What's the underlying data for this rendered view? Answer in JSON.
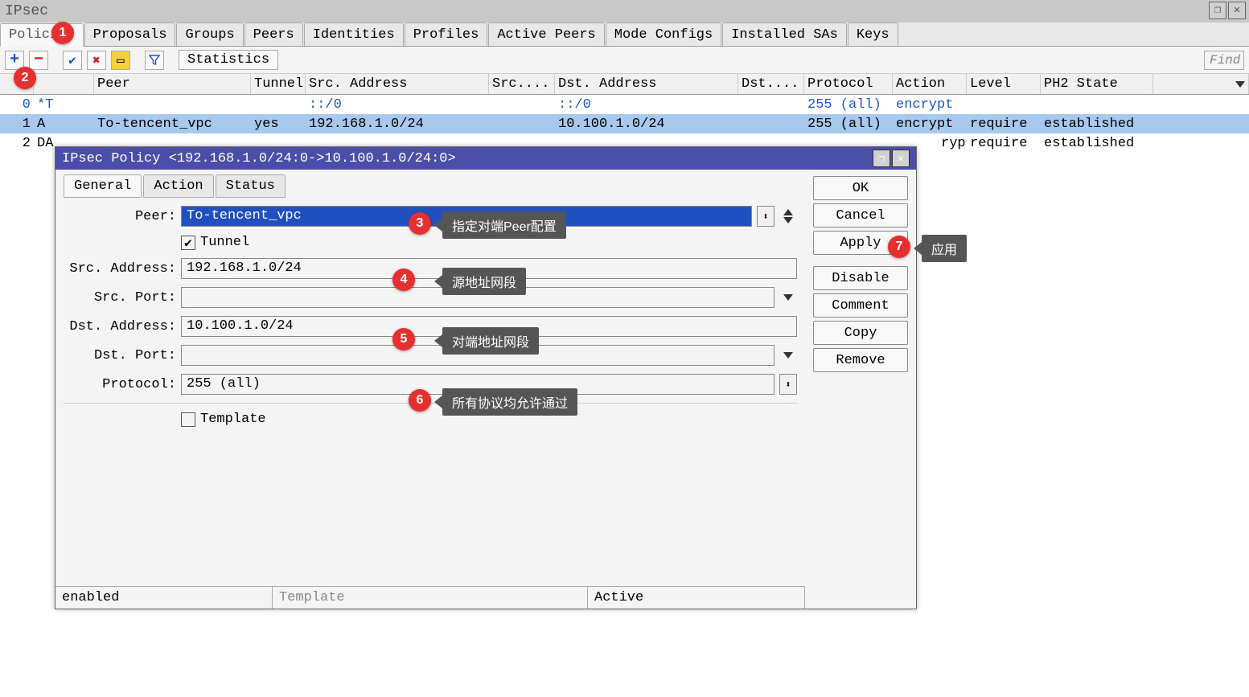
{
  "window": {
    "title": "IPsec"
  },
  "tabs": [
    "Policies",
    "Proposals",
    "Groups",
    "Peers",
    "Identities",
    "Profiles",
    "Active Peers",
    "Mode Configs",
    "Installed SAs",
    "Keys"
  ],
  "toolbar": {
    "statistics": "Statistics",
    "find": "Find"
  },
  "grid": {
    "headers": {
      "num": "#",
      "peer": "Peer",
      "tunnel": "Tunnel",
      "src": "Src. Address",
      "srcport": "Src....",
      "dst": "Dst. Address",
      "dstport": "Dst....",
      "proto": "Protocol",
      "action": "Action",
      "level": "Level",
      "ph2": "PH2 State"
    },
    "rows": [
      {
        "num": "0",
        "flag": "*T",
        "peer": "",
        "tunnel": "",
        "src": "::/0",
        "srcport": "",
        "dst": "::/0",
        "dstport": "",
        "proto": "255 (all)",
        "action": "encrypt",
        "level": "",
        "ph2": ""
      },
      {
        "num": "1",
        "flag": "A",
        "peer": "To-tencent_vpc",
        "tunnel": "yes",
        "src": "192.168.1.0/24",
        "srcport": "",
        "dst": "10.100.1.0/24",
        "dstport": "",
        "proto": "255 (all)",
        "action": "encrypt",
        "level": "require",
        "ph2": "established"
      },
      {
        "num": "2",
        "flag": "DA",
        "peer": "",
        "tunnel": "",
        "src": "",
        "srcport": "",
        "dst": "",
        "dstport": "",
        "proto": "",
        "action": "rypt",
        "level": "require",
        "ph2": "established"
      }
    ]
  },
  "dialog": {
    "title": "IPsec Policy <192.168.1.0/24:0->10.100.1.0/24:0>",
    "tabs": [
      "General",
      "Action",
      "Status"
    ],
    "labels": {
      "peer": "Peer:",
      "tunnel": "Tunnel",
      "src": "Src. Address:",
      "srcport": "Src. Port:",
      "dst": "Dst. Address:",
      "dstport": "Dst. Port:",
      "proto": "Protocol:",
      "template": "Template"
    },
    "values": {
      "peer": "To-tencent_vpc",
      "src": "192.168.1.0/24",
      "srcport": "",
      "dst": "10.100.1.0/24",
      "dstport": "",
      "proto": "255 (all)"
    },
    "buttons": {
      "ok": "OK",
      "cancel": "Cancel",
      "apply": "Apply",
      "disable": "Disable",
      "comment": "Comment",
      "copy": "Copy",
      "remove": "Remove"
    },
    "status": {
      "enabled": "enabled",
      "template": "Template",
      "active": "Active"
    }
  },
  "annotations": {
    "n1": "1",
    "n2": "2",
    "n3": "3",
    "n4": "4",
    "n5": "5",
    "n6": "6",
    "n7": "7",
    "c3": "指定对端Peer配置",
    "c4": "源地址网段",
    "c5": "对端地址网段",
    "c6": "所有协议均允许通过",
    "c7": "应用"
  }
}
